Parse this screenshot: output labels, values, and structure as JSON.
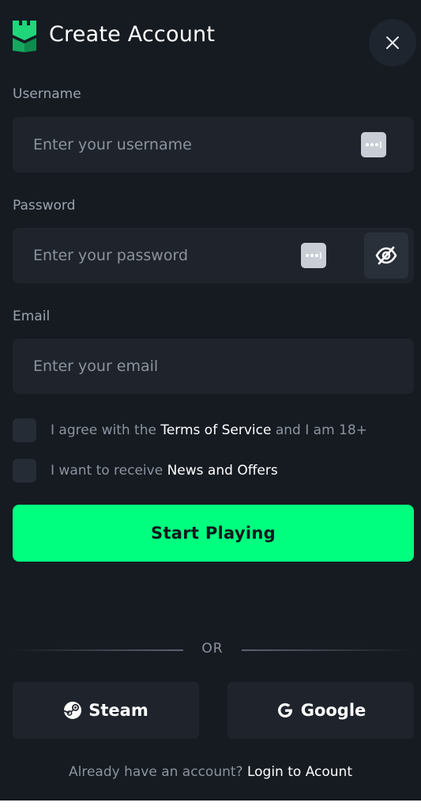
{
  "header": {
    "title": "Create Account",
    "logo_icon": "castle-tower-icon",
    "close_icon": "close-icon"
  },
  "username": {
    "label": "Username",
    "placeholder": "Enter your username",
    "value": ""
  },
  "password": {
    "label": "Password",
    "placeholder": "Enter your password",
    "value": "",
    "toggle_icon": "eye-slash-icon"
  },
  "email": {
    "label": "Email",
    "placeholder": "Enter your email",
    "value": ""
  },
  "terms": {
    "prefix": "I agree with the ",
    "link": "Terms of Service",
    "suffix": " and I am 18+",
    "checked": false
  },
  "news": {
    "prefix": "I want to receive ",
    "link": "News and Offers",
    "checked": false
  },
  "primary_button": "Start Playing",
  "divider_text": "OR",
  "social": {
    "steam_label": "Steam",
    "steam_icon": "steam-icon",
    "google_label": "Google",
    "google_icon": "google-icon"
  },
  "footer": {
    "text": "Already have an account? ",
    "link": "Login to Acount"
  },
  "colors": {
    "background": "#161b22",
    "field": "#1f242c",
    "accent": "#00ff7f",
    "brand_green": "#1fd67b",
    "muted_text": "#8b939e"
  }
}
